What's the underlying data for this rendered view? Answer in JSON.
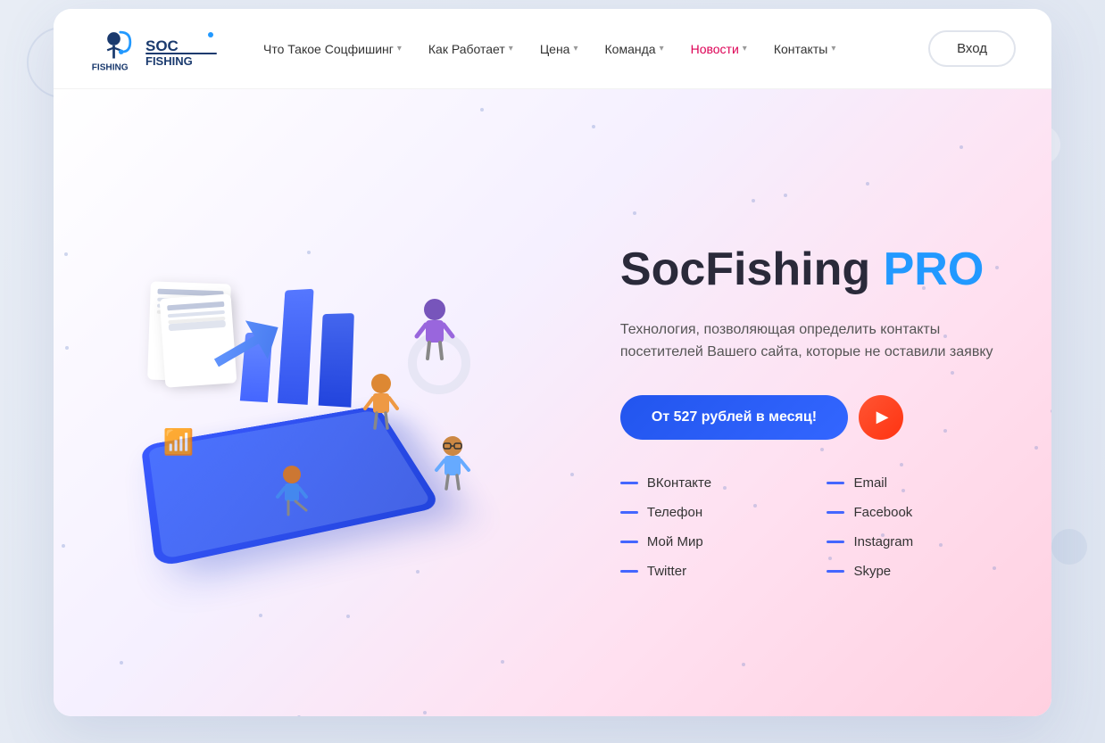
{
  "page": {
    "title": "SocFishing PRO"
  },
  "navbar": {
    "login_label": "Вход",
    "links": [
      {
        "id": "what",
        "label": "Что Такое Соцфишинг",
        "has_dropdown": true,
        "active": false
      },
      {
        "id": "how",
        "label": "Как Работает",
        "has_dropdown": true,
        "active": false
      },
      {
        "id": "price",
        "label": "Цена",
        "has_dropdown": true,
        "active": false
      },
      {
        "id": "team",
        "label": "Команда",
        "has_dropdown": true,
        "active": false
      },
      {
        "id": "news",
        "label": "Новости",
        "has_dropdown": true,
        "active": true
      },
      {
        "id": "contacts",
        "label": "Контакты",
        "has_dropdown": true,
        "active": false
      }
    ]
  },
  "hero": {
    "title_part1": "SocFishing ",
    "title_part2": "PRO",
    "description": "Технология, позволяющая определить контакты посетителей Вашего сайта, которые не оставили заявку",
    "cta": {
      "prefix": "От ",
      "price": "527",
      "suffix": " рублей в месяц!"
    },
    "contacts_left": [
      {
        "id": "vk",
        "label": "ВКонтакте"
      },
      {
        "id": "phone",
        "label": "Телефон"
      },
      {
        "id": "myworld",
        "label": "Мой Мир"
      },
      {
        "id": "twitter",
        "label": "Twitter"
      }
    ],
    "contacts_right": [
      {
        "id": "email",
        "label": "Email"
      },
      {
        "id": "facebook",
        "label": "Facebook"
      },
      {
        "id": "instagram",
        "label": "Instagram"
      },
      {
        "id": "skype",
        "label": "Skype"
      }
    ]
  },
  "colors": {
    "accent_blue": "#2299ff",
    "btn_gradient_start": "#2255ee",
    "btn_gradient_end": "#3366ff",
    "play_btn": "#ff4422",
    "dash_color": "#4466ff",
    "nav_active": "#dd0055"
  }
}
